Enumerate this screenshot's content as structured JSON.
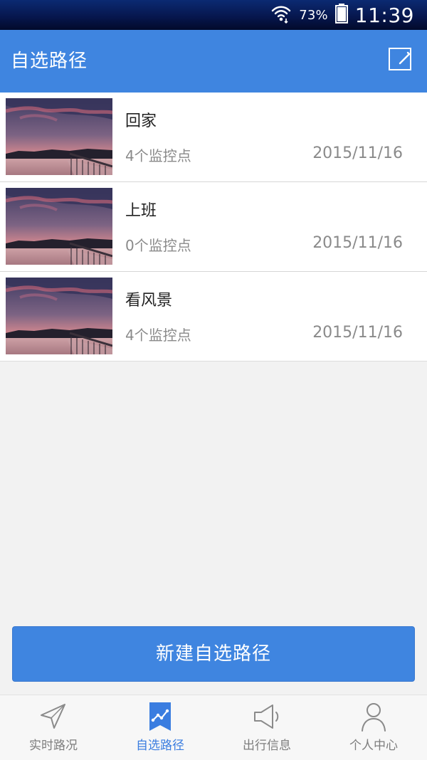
{
  "status_bar": {
    "battery_percent": "73%",
    "time": "11:39"
  },
  "app_bar": {
    "title": "自选路径",
    "edit_icon": "edit-icon"
  },
  "routes": [
    {
      "name": "回家",
      "monitor_count": "4个监控点",
      "date": "2015/11/16"
    },
    {
      "name": "上班",
      "monitor_count": "0个监控点",
      "date": "2015/11/16"
    },
    {
      "name": "看风景",
      "monitor_count": "4个监控点",
      "date": "2015/11/16"
    }
  ],
  "actions": {
    "new_route_label": "新建自选路径"
  },
  "bottom_nav": {
    "items": [
      {
        "label": "实时路况",
        "icon": "navigation-arrow-icon",
        "active": false
      },
      {
        "label": "自选路径",
        "icon": "route-bookmark-icon",
        "active": true
      },
      {
        "label": "出行信息",
        "icon": "speaker-icon",
        "active": false
      },
      {
        "label": "个人中心",
        "icon": "user-icon",
        "active": false
      }
    ]
  },
  "colors": {
    "primary": "#3f85e0",
    "active_tab": "#3a7de0",
    "muted_text": "#8a8a8a",
    "status_bar": "#06154b"
  }
}
